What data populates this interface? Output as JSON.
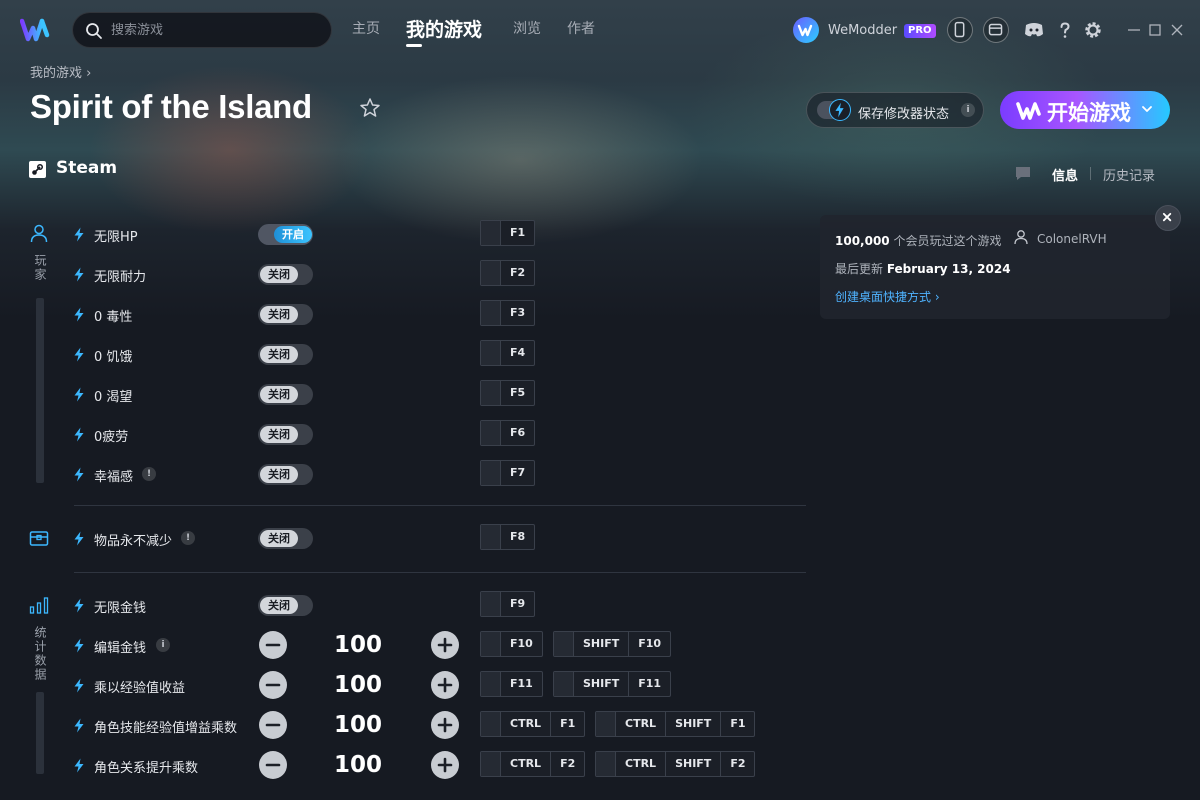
{
  "colors": {
    "accent": "#3cc4ff",
    "brand_purple": "#7b3cff",
    "background": "#161a22"
  },
  "topbar": {
    "search_placeholder": "搜索游戏",
    "nav": [
      "主页",
      "我的游戏",
      "浏览",
      "作者"
    ],
    "active_nav": "我的游戏",
    "username": "WeModder",
    "pro_badge": "PRO"
  },
  "header": {
    "breadcrumb": "我的游戏 ›",
    "title": "Spirit of the Island",
    "platform": "Steam",
    "save_state_label": "保存修改器状态",
    "play_label": "开始游戏",
    "tabs": [
      "信息",
      "历史记录"
    ]
  },
  "categories": {
    "player": "玩家",
    "stats": "统计数据"
  },
  "cheats": [
    {
      "name": "无限HP",
      "type": "toggle",
      "state": "开启",
      "on": true,
      "keys": [
        [
          "F1"
        ]
      ]
    },
    {
      "name": "无限耐力",
      "type": "toggle",
      "state": "关闭",
      "on": false,
      "keys": [
        [
          "F2"
        ]
      ]
    },
    {
      "name": "0 毒性",
      "type": "toggle",
      "state": "关闭",
      "on": false,
      "keys": [
        [
          "F3"
        ]
      ]
    },
    {
      "name": "0 饥饿",
      "type": "toggle",
      "state": "关闭",
      "on": false,
      "keys": [
        [
          "F4"
        ]
      ]
    },
    {
      "name": "0 渴望",
      "type": "toggle",
      "state": "关闭",
      "on": false,
      "keys": [
        [
          "F5"
        ]
      ]
    },
    {
      "name": "0疲劳",
      "type": "toggle",
      "state": "关闭",
      "on": false,
      "keys": [
        [
          "F6"
        ]
      ]
    },
    {
      "name": "幸福感",
      "type": "toggle",
      "state": "关闭",
      "on": false,
      "note": "!",
      "keys": [
        [
          "F7"
        ]
      ]
    },
    {
      "name": "物品永不减少",
      "type": "toggle",
      "state": "关闭",
      "on": false,
      "note": "!",
      "keys": [
        [
          "F8"
        ]
      ]
    },
    {
      "name": "无限金钱",
      "type": "toggle",
      "state": "关闭",
      "on": false,
      "keys": [
        [
          "F9"
        ]
      ]
    },
    {
      "name": "编辑金钱",
      "type": "stepper",
      "value": "100",
      "note": "i",
      "keys": [
        [
          "F10"
        ],
        [
          "SHIFT",
          "F10"
        ]
      ]
    },
    {
      "name": "乘以经验值收益",
      "type": "stepper",
      "value": "100",
      "keys": [
        [
          "F11"
        ],
        [
          "SHIFT",
          "F11"
        ]
      ]
    },
    {
      "name": "角色技能经验值增益乘数",
      "type": "stepper",
      "value": "100",
      "keys": [
        [
          "CTRL",
          "F1"
        ],
        [
          "CTRL",
          "SHIFT",
          "F1"
        ]
      ]
    },
    {
      "name": "角色关系提升乘数",
      "type": "stepper",
      "value": "100",
      "keys": [
        [
          "CTRL",
          "F2"
        ],
        [
          "CTRL",
          "SHIFT",
          "F2"
        ]
      ]
    }
  ],
  "info_panel": {
    "players_count": "100,000",
    "players_text": " 个会员玩过这个游戏",
    "author": "ColonelRVH",
    "updated_label": "最后更新 ",
    "updated_date": "February 13, 2024",
    "shortcut_label": "创建桌面快捷方式 ›"
  }
}
